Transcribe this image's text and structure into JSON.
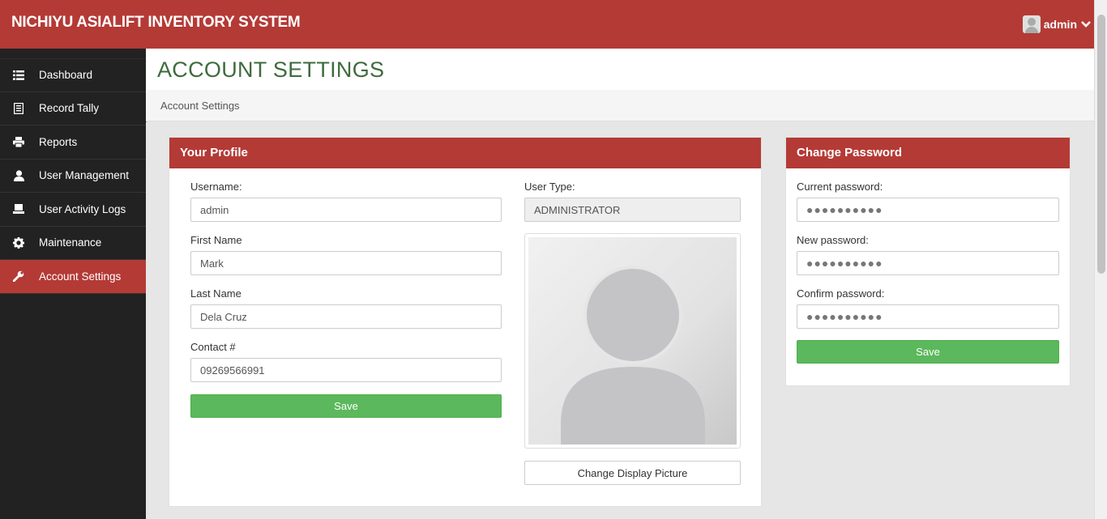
{
  "app": {
    "title": "NICHIYU ASIALIFT INVENTORY SYSTEM"
  },
  "user_menu": {
    "name": "admin",
    "avatar_icon": "user-avatar-icon",
    "chevron_icon": "chevron-down-icon"
  },
  "sidebar": {
    "items": [
      {
        "label": "Dashboard",
        "icon": "list-icon"
      },
      {
        "label": "Record Tally",
        "icon": "document-icon"
      },
      {
        "label": "Reports",
        "icon": "printer-icon"
      },
      {
        "label": "User Management",
        "icon": "user-icon"
      },
      {
        "label": "User Activity Logs",
        "icon": "laptop-icon"
      },
      {
        "label": "Maintenance",
        "icon": "gear-icon"
      },
      {
        "label": "Account Settings",
        "icon": "wrench-icon",
        "active": true
      }
    ]
  },
  "page": {
    "title": "ACCOUNT SETTINGS",
    "breadcrumb": "Account Settings"
  },
  "profile": {
    "heading": "Your Profile",
    "username_label": "Username:",
    "username_value": "admin",
    "first_name_label": "First Name",
    "first_name_value": "Mark",
    "last_name_label": "Last Name",
    "last_name_value": "Dela Cruz",
    "contact_label": "Contact #",
    "contact_value": "09269566991",
    "save_label": "Save",
    "user_type_label": "User Type:",
    "user_type_value": "ADMINISTRATOR",
    "change_picture_label": "Change Display Picture"
  },
  "password": {
    "heading": "Change Password",
    "current_label": "Current password:",
    "current_value": "●●●●●●●●●●",
    "new_label": "New password:",
    "new_value": "●●●●●●●●●●",
    "confirm_label": "Confirm password:",
    "confirm_value": "●●●●●●●●●●",
    "save_label": "Save"
  },
  "colors": {
    "brand": "#b43a35",
    "title_green": "#3e6b3e",
    "success": "#5cb85c",
    "sidebar": "#222222"
  }
}
